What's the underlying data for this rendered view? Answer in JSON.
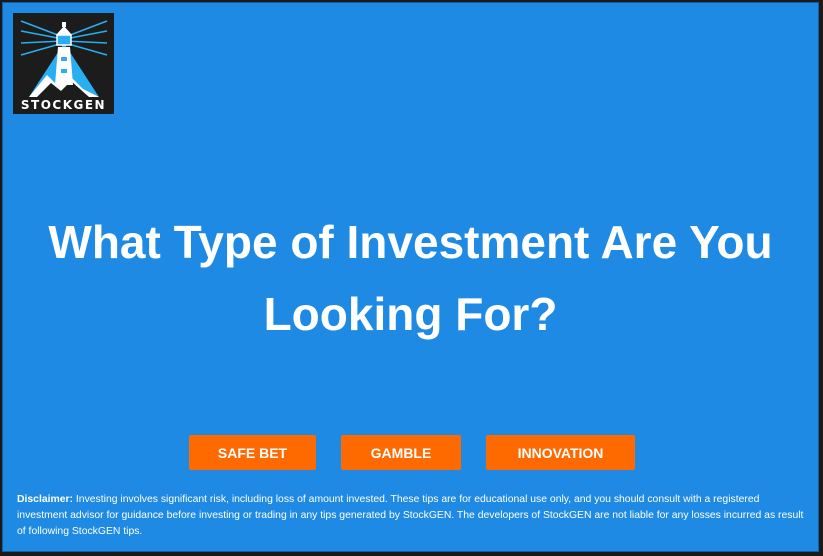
{
  "brand": {
    "name": "STOCKGEN",
    "logo_icon": "lighthouse-icon",
    "colors": {
      "logo_bg": "#1c1c1c",
      "logo_accent": "#2aaef0"
    }
  },
  "main": {
    "headline": "What Type of Investment Are You Looking For?",
    "background_color": "#1e8ae4"
  },
  "buttons": {
    "safe_bet": "SAFE BET",
    "gamble": "GAMBLE",
    "innovation": "INNOVATION",
    "color": "#ff6a00"
  },
  "disclaimer": {
    "label": "Disclaimer:",
    "text": " Investing involves significant risk, including loss of amount invested. These tips are for educational use only, and you should consult with a registered investment advisor for guidance before investing or trading in any tips generated by StockGEN. The developers of StockGEN are not liable for any losses incurred as result of following StockGEN tips."
  }
}
